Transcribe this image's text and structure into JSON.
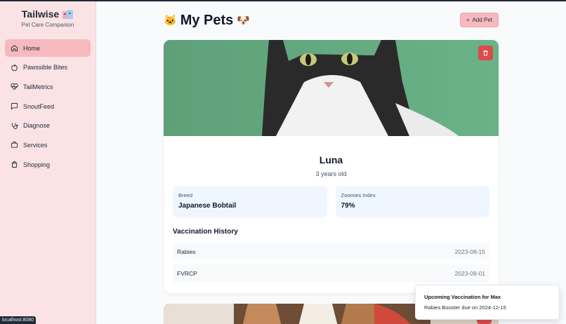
{
  "brand": {
    "title": "Tailwise",
    "subtitle": "Pet Care Companion"
  },
  "sidebar": {
    "items": [
      {
        "label": "Home",
        "icon": "home-icon",
        "active": true
      },
      {
        "label": "Pawssible Bites",
        "icon": "apple-icon"
      },
      {
        "label": "TailMetrics",
        "icon": "heart-pulse-icon"
      },
      {
        "label": "SnoutFeed",
        "icon": "message-icon"
      },
      {
        "label": "Diagnose",
        "icon": "stethoscope-icon"
      },
      {
        "label": "Services",
        "icon": "briefcase-icon"
      },
      {
        "label": "Shopping",
        "icon": "shopping-bag-icon"
      }
    ]
  },
  "header": {
    "title": "My Pets",
    "emoji_left": "🐱",
    "emoji_right": "🐶",
    "add_label": "Add Pet"
  },
  "pet": {
    "name": "Luna",
    "age": "3 years old",
    "breed_label": "Breed",
    "breed": "Japanese Bobtail",
    "zoomies_label": "Zoomies Index",
    "zoomies": "79%",
    "vaccination_title": "Vaccination History",
    "vaccinations": [
      {
        "name": "Rabies",
        "date": "2023-08-15"
      },
      {
        "name": "FVRCP",
        "date": "2023-09-01"
      }
    ]
  },
  "toast": {
    "title": "Upcoming Vaccination for Max",
    "body": "Rabies Booster due on 2024-12-15"
  },
  "status_bar": {
    "url": "localhost:8080"
  },
  "colors": {
    "sidebar_bg": "#fbe3e5",
    "accent": "#f6b9be",
    "danger": "#dc4b4b",
    "info_bg": "#eff6ff"
  }
}
